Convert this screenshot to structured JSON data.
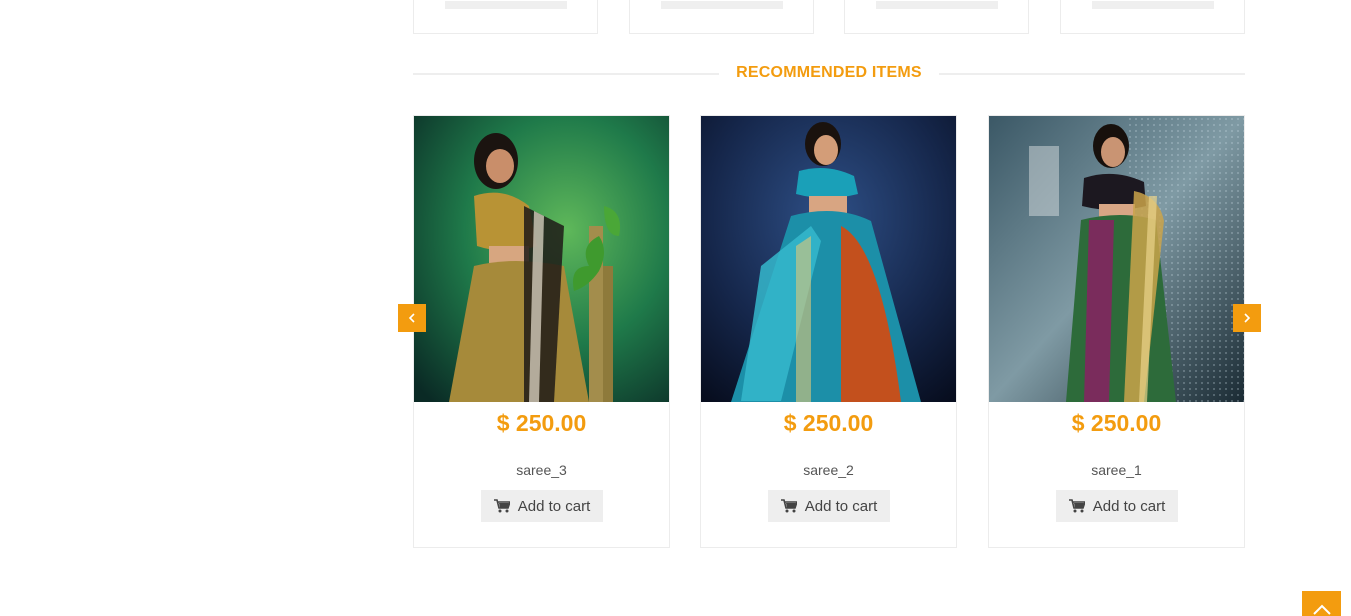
{
  "section": {
    "title": "RECOMMENDED ITEMS"
  },
  "products": [
    {
      "price": "$ 250.00",
      "name": "saree_3",
      "cart_label": "Add to cart"
    },
    {
      "price": "$ 250.00",
      "name": "saree_2",
      "cart_label": "Add to cart"
    },
    {
      "price": "$ 250.00",
      "name": "saree_1",
      "cart_label": "Add to cart"
    }
  ],
  "colors": {
    "accent": "#f39c0f",
    "button_bg": "#eeeeee",
    "border": "#ececec"
  },
  "icons": {
    "prev": "chevron-left-icon",
    "next": "chevron-right-icon",
    "cart": "cart-icon",
    "top": "chevron-up-icon"
  }
}
